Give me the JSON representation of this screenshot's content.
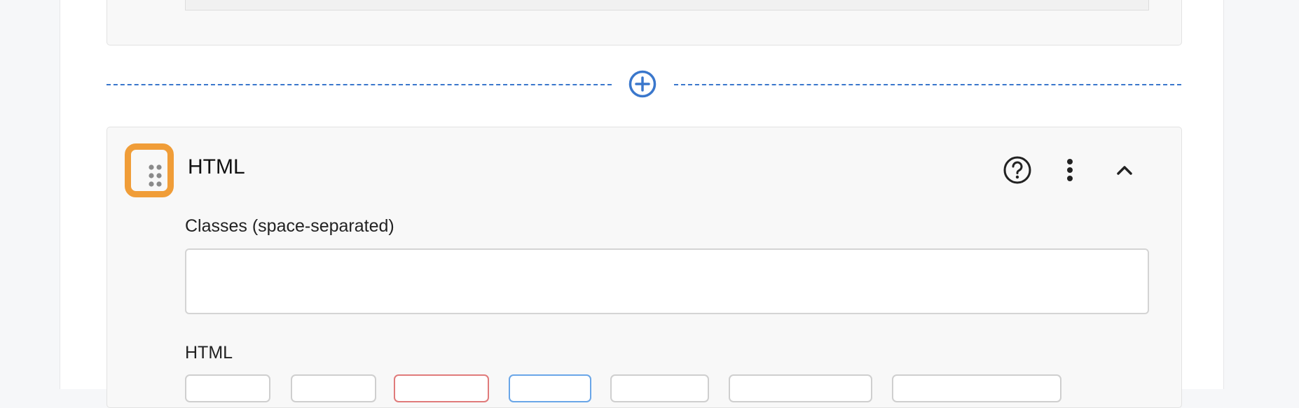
{
  "block": {
    "title": "HTML",
    "classes_label": "Classes (space-separated)",
    "classes_value": "",
    "html_label": "HTML"
  },
  "icons": {
    "add": "plus-circle-icon",
    "drag": "drag-handle-icon",
    "help": "help-circle-icon",
    "more": "more-vertical-icon",
    "collapse": "chevron-up-icon"
  },
  "colors": {
    "accent": "#3a77cc",
    "highlight": "#f09d38",
    "danger_outline": "#e07b7b",
    "active_outline": "#6aa6e8"
  }
}
